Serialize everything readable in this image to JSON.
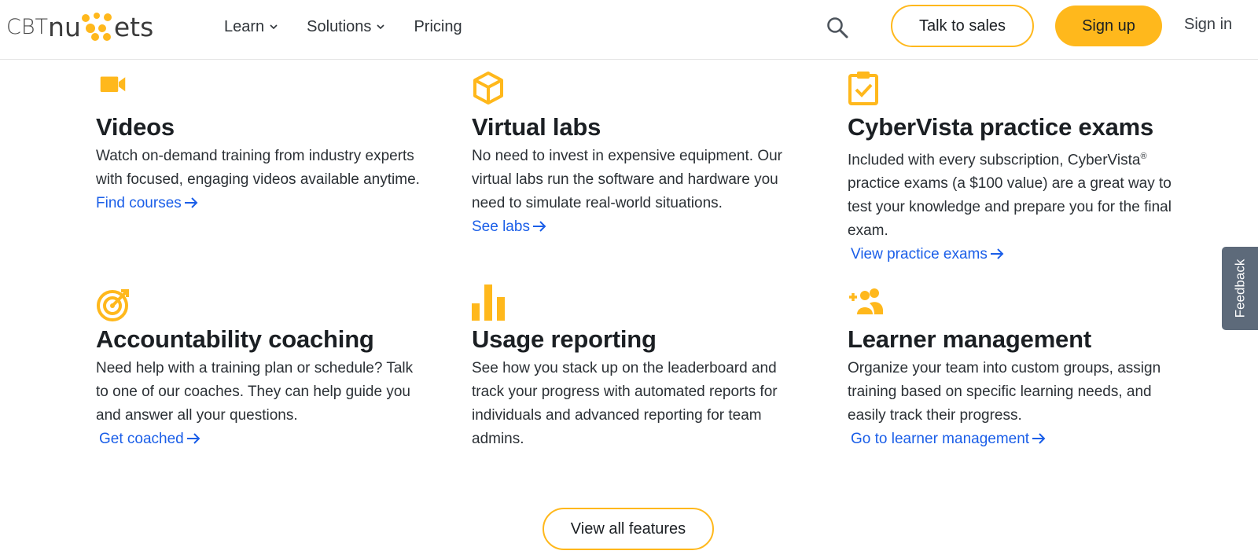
{
  "brand": {
    "logo_cbt": "CBT",
    "logo_nu": "nu",
    "logo_ets": "ets",
    "accent": "#ffb81c",
    "link_color": "#1a5ee8"
  },
  "nav": {
    "learn": "Learn",
    "solutions": "Solutions",
    "pricing": "Pricing",
    "search_icon": "search-icon",
    "talk_to_sales": "Talk to sales",
    "sign_up": "Sign up",
    "sign_in": "Sign in"
  },
  "features": [
    {
      "icon": "video-camera-icon",
      "title": "Videos",
      "body": "Watch on-demand training from industry experts with focused, engaging videos available anytime.",
      "link": "Find courses"
    },
    {
      "icon": "cube-icon",
      "title": "Virtual labs",
      "body": "No need to invest in expensive equipment. Our virtual labs run the software and hardware you need to simulate real-world situations.",
      "link": "See labs"
    },
    {
      "icon": "clipboard-check-icon",
      "title": "CyberVista practice exams",
      "body_pre": "Included with every subscription, CyberVista",
      "reg": "®",
      "body_post": " practice exams (a $100 value) are a great way to test your knowledge and prepare you for the final exam.",
      "link": "View practice exams"
    },
    {
      "icon": "target-icon",
      "title": "Accountability coaching",
      "body": "Need help with a training plan or schedule? Talk to one of our coaches. They can help guide you and answer all your questions.",
      "link": "Get coached"
    },
    {
      "icon": "bar-chart-icon",
      "title": "Usage reporting",
      "body": "See how you stack up on the leaderboard and track your progress with automated reports for individuals and advanced reporting for team admins."
    },
    {
      "icon": "add-users-icon",
      "title": "Learner management",
      "body": "Organize your team into custom groups, assign training based on specific learning needs, and easily track their progress.",
      "link": "Go to learner management"
    }
  ],
  "view_all": "View all features",
  "feedback": "Feedback"
}
